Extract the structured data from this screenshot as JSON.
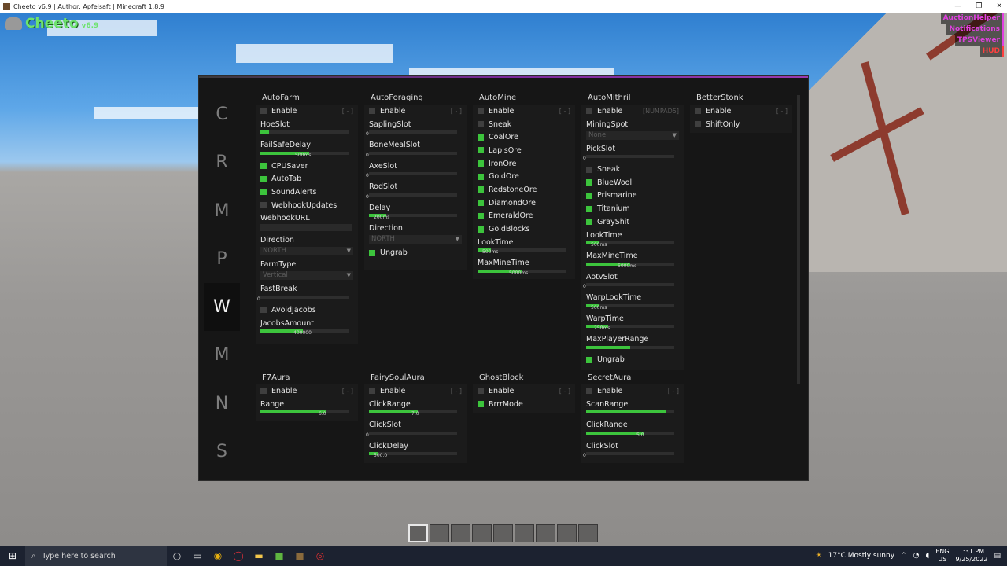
{
  "window": {
    "title": "Cheeto v6.9 | Author: Apfelsaft | Minecraft 1.8.9"
  },
  "brand": {
    "name": "Cheeto",
    "version": "v6.9"
  },
  "hud_list": [
    "AuctionHelper",
    "Notifications",
    "TPSViewer",
    "HUD"
  ],
  "categories": [
    "C",
    "R",
    "M",
    "P",
    "W",
    "M",
    "N",
    "S"
  ],
  "active_category": "W",
  "modules": {
    "autofarm": {
      "title": "AutoFarm",
      "enable": "Enable",
      "key": "[ - ]",
      "hoeslot": "HoeSlot",
      "failsafe": "FailSafeDelay",
      "failsafe_val": "500ms",
      "cpusaver": "CPUSaver",
      "autotab": "AutoTab",
      "soundalerts": "SoundAlerts",
      "webhookupdates": "WebhookUpdates",
      "webhookurl": "WebhookURL",
      "direction": "Direction",
      "direction_val": "NORTH",
      "farmtype": "FarmType",
      "farmtype_val": "Vertical",
      "fastbreak": "FastBreak",
      "fastbreak_val": "0",
      "avoidjacobs": "AvoidJacobs",
      "jacobs": "JacobsAmount",
      "jacobs_val": "400000"
    },
    "autoforaging": {
      "title": "AutoForaging",
      "enable": "Enable",
      "key": "[ - ]",
      "sapling": "SaplingSlot",
      "sapling_val": "0",
      "bonemeal": "BoneMealSlot",
      "bonemeal_val": "0",
      "axe": "AxeSlot",
      "axe_val": "0",
      "rod": "RodSlot",
      "rod_val": "0",
      "delay": "Delay",
      "delay_val": "200ms",
      "direction": "Direction",
      "direction_val": "NORTH",
      "ungrab": "Ungrab"
    },
    "automine": {
      "title": "AutoMine",
      "enable": "Enable",
      "key": "[ - ]",
      "sneak": "Sneak",
      "coalore": "CoalOre",
      "lapisore": "LapisOre",
      "ironore": "IronOre",
      "goldore": "GoldOre",
      "redstoneore": "RedstoneOre",
      "diamondore": "DiamondOre",
      "emeraldore": "EmeraldOre",
      "goldblocks": "GoldBlocks",
      "looktime": "LookTime",
      "looktime_val": "500ms",
      "maxmine": "MaxMineTime",
      "maxmine_val": "5000ms"
    },
    "automithril": {
      "title": "AutoMithril",
      "enable": "Enable",
      "key": "[NUMPAD5]",
      "miningspot": "MiningSpot",
      "miningspot_val": "None",
      "pickslot": "PickSlot",
      "pickslot_val": "0",
      "sneak": "Sneak",
      "bluewool": "BlueWool",
      "prismarine": "Prismarine",
      "titanium": "Titanium",
      "grayshit": "GrayShit",
      "looktime": "LookTime",
      "looktime_val": "500ms",
      "maxmine": "MaxMineTime",
      "maxmine_val": "5000ms",
      "aotv": "AotvSlot",
      "aotv_val": "0",
      "warplook": "WarpLookTime",
      "warplook_val": "500ms",
      "warptime": "WarpTime",
      "warptime_val": "250ms",
      "maxplayer": "MaxPlayerRange",
      "ungrab": "Ungrab"
    },
    "betterstonk": {
      "title": "BetterStonk",
      "enable": "Enable",
      "key": "[ - ]",
      "shiftonly": "ShiftOnly"
    },
    "f7aura": {
      "title": "F7Aura",
      "enable": "Enable",
      "key": "[ - ]",
      "range": "Range",
      "range_val": "6.0"
    },
    "fairysoul": {
      "title": "FairySoulAura",
      "enable": "Enable",
      "key": "[ - ]",
      "clickrange": "ClickRange",
      "clickrange_val": "7.0",
      "clickslot": "ClickSlot",
      "clickslot_val": "0",
      "clickdelay": "ClickDelay",
      "clickdelay_val": "500.0"
    },
    "ghostblock": {
      "title": "GhostBlock",
      "enable": "Enable",
      "key": "[ - ]",
      "brrr": "BrrrMode"
    },
    "secretaura": {
      "title": "SecretAura",
      "enable": "Enable",
      "key": "[ - ]",
      "scanrange": "ScanRange",
      "clickrange": "ClickRange",
      "clickrange_val": "5.0",
      "clickslot": "ClickSlot",
      "clickslot_val": "0"
    }
  },
  "levels": {
    "hoeslot": 0.1,
    "failsafe": 0.55,
    "fastbreak": 0.0,
    "jacobs": 0.48,
    "sapling": 0.0,
    "bonemeal": 0.0,
    "axe": 0.0,
    "rod": 0.0,
    "delay": 0.2,
    "automine_looktime": 0.15,
    "automine_maxmine": 0.5,
    "pickslot": 0.0,
    "mithril_looktime": 0.15,
    "mithril_maxmine": 0.5,
    "aotv": 0.0,
    "warplook": 0.15,
    "warptime": 0.25,
    "maxplayer": 0.5,
    "f7range": 0.75,
    "fs_clickrange": 0.55,
    "fs_clickslot": 0.0,
    "fs_clickdelay": 0.1,
    "scanrange": 0.9,
    "sa_clickrange": 0.65,
    "sa_clickslot": 0.0
  },
  "taskbar": {
    "search_placeholder": "Type here to search",
    "weather": "17°C  Mostly sunny",
    "lang_top": "ENG",
    "lang_bottom": "US",
    "time": "1:31 PM",
    "date": "9/25/2022"
  },
  "colors": {
    "accent": "#3cc43c",
    "panel": "#161616",
    "hud_pink": "#e040e0"
  }
}
